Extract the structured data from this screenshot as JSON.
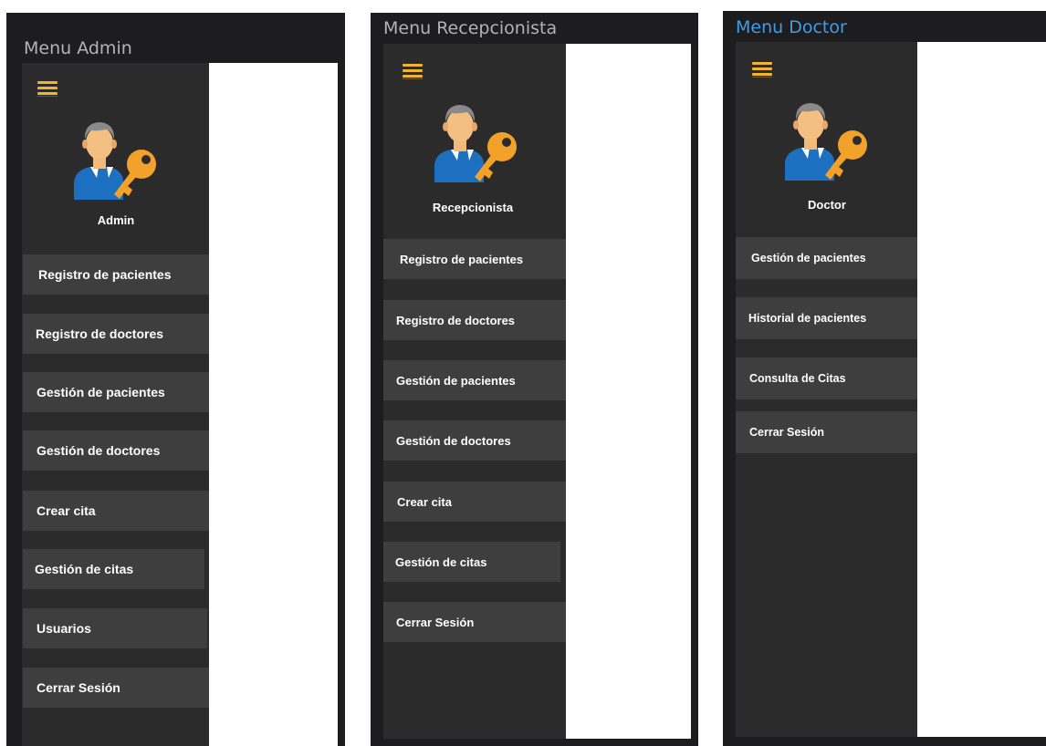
{
  "panels": [
    {
      "title": "Menu Admin",
      "role": "Admin",
      "items": [
        "Registro de pacientes",
        "Registro de doctores",
        "Gestión de pacientes",
        "Gestión de doctores",
        "Crear cita",
        "Gestión de citas",
        "Usuarios",
        "Cerrar Sesión"
      ]
    },
    {
      "title": "Menu Recepcionista",
      "role": "Recepcionista",
      "items": [
        "Registro de pacientes",
        "Registro de doctores",
        "Gestión de pacientes",
        "Gestión de doctores",
        "Crear cita",
        "Gestión de citas",
        "Cerrar Sesión"
      ]
    },
    {
      "title": "Menu Doctor",
      "role": "Doctor",
      "items": [
        "Gestión de pacientes",
        "Historial de pacientes",
        "Consulta de Citas",
        "Cerrar Sesión"
      ]
    }
  ],
  "icons": {
    "menu": "hamburger-icon",
    "avatar": "user-key-icon"
  },
  "colors": {
    "panel_bg": "#1d1d1f",
    "sidebar_bg": "#2c2b2b",
    "button_bg": "#3f3e3e",
    "title_gray": "#b3b3b3",
    "title_blue": "#3f9ee8",
    "hamburger": "#f0b52e",
    "key": "#f2a22a"
  }
}
